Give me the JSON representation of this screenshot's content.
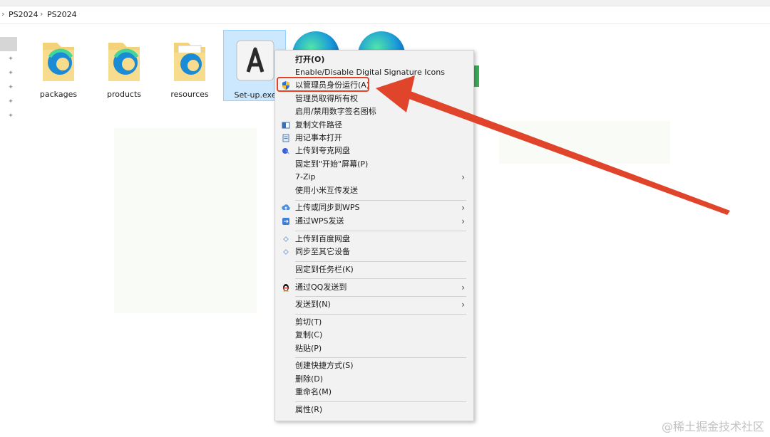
{
  "address": {
    "segments": [
      "PS2024",
      "PS2024"
    ],
    "separator": "›"
  },
  "files": [
    {
      "name": "packages",
      "type": "folder"
    },
    {
      "name": "products",
      "type": "folder"
    },
    {
      "name": "resources",
      "type": "folder"
    },
    {
      "name": "Set-up.exe",
      "type": "exe",
      "selected": true
    }
  ],
  "context_menu": {
    "items": [
      {
        "label": "打开(O)",
        "bold": true
      },
      {
        "label": "Enable/Disable Digital Signature Icons"
      },
      {
        "label": "以管理员身份运行(A)",
        "icon": "uac-shield-icon",
        "highlighted": true
      },
      {
        "label": "管理员取得所有权"
      },
      {
        "label": "启用/禁用数字签名图标"
      },
      {
        "label": "复制文件路径",
        "icon": "copy-path-icon"
      },
      {
        "label": "用记事本打开",
        "icon": "notepad-icon"
      },
      {
        "label": "上传到夸克网盘",
        "icon": "quark-cloud-icon"
      },
      {
        "label": "固定到\"开始\"屏幕(P)"
      },
      {
        "label": "7-Zip",
        "submenu": true
      },
      {
        "label": "使用小米互传发送"
      },
      {
        "label": "上传或同步到WPS",
        "icon": "wps-cloud-icon",
        "submenu": true
      },
      {
        "label": "通过WPS发送",
        "icon": "wps-send-icon",
        "submenu": true
      },
      {
        "label": "上传到百度网盘",
        "icon": "baidu-cloud-icon"
      },
      {
        "label": "同步至其它设备",
        "icon": "baidu-sync-icon"
      },
      {
        "label": "固定到任务栏(K)"
      },
      {
        "label": "通过QQ发送到",
        "icon": "qq-penguin-icon",
        "submenu": true
      },
      {
        "label": "发送到(N)",
        "submenu": true
      },
      {
        "label": "剪切(T)"
      },
      {
        "label": "复制(C)"
      },
      {
        "label": "粘贴(P)"
      },
      {
        "label": "创建快捷方式(S)"
      },
      {
        "label": "删除(D)"
      },
      {
        "label": "重命名(M)"
      },
      {
        "label": "属性(R)"
      }
    ]
  },
  "watermark": "@稀土掘金技术社区",
  "colors": {
    "accent": "#e0452b",
    "menu_bg": "#f2f2f2",
    "selection": "#cce8ff"
  }
}
